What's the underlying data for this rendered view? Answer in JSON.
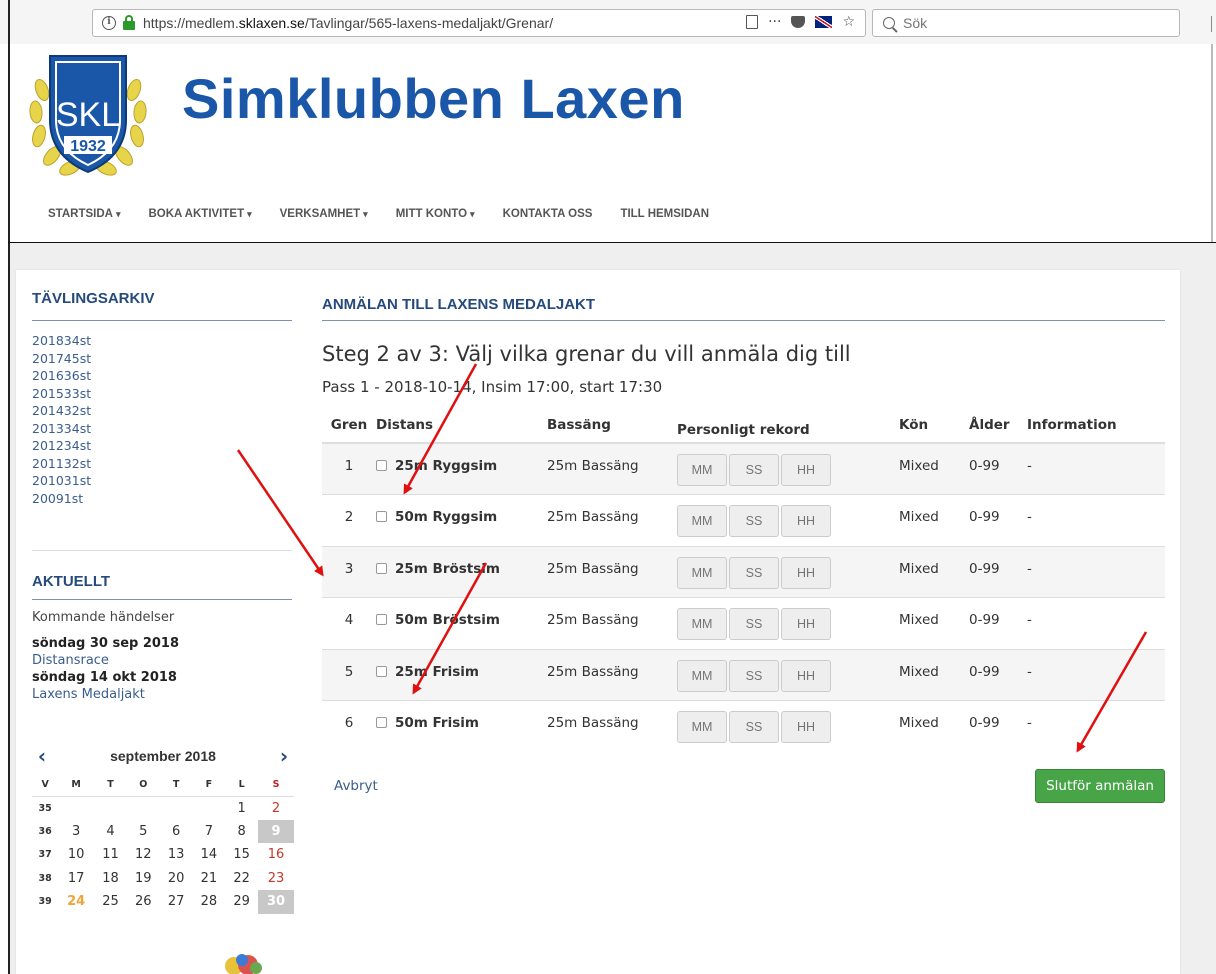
{
  "browser": {
    "url_prefix": "https://medlem.",
    "url_domain": "sklaxen.se",
    "url_path": "/Tavlingar/565-laxens-medaljakt/Grenar/",
    "search_placeholder": "Sök",
    "menu_dots": "···",
    "star": "☆"
  },
  "site": {
    "title": "Simklubben Laxen",
    "logo_text": "SKL",
    "logo_year": "1932"
  },
  "nav": [
    {
      "label": "STARTSIDA",
      "caret": "▾"
    },
    {
      "label": "BOKA AKTIVITET",
      "caret": "▾"
    },
    {
      "label": "VERKSAMHET",
      "caret": "▾"
    },
    {
      "label": "MITT KONTO",
      "caret": "▾"
    },
    {
      "label": "KONTAKTA OSS",
      "caret": ""
    },
    {
      "label": "TILL HEMSIDAN",
      "caret": ""
    }
  ],
  "sidebar": {
    "archive_heading": "TÄVLINGSARKIV",
    "archive": [
      "201834st",
      "201745st",
      "201636st",
      "201533st",
      "201432st",
      "201334st",
      "201234st",
      "201132st",
      "201031st",
      "20091st"
    ],
    "news_heading": "AKTUELLT",
    "upcoming_label": "Kommande händelser",
    "events": [
      {
        "date": "söndag 30 sep 2018",
        "name": "Distansrace"
      },
      {
        "date": "söndag 14 okt 2018",
        "name": "Laxens Medaljakt"
      }
    ]
  },
  "calendar": {
    "prev": "‹",
    "next": "›",
    "title": "september 2018",
    "headers": [
      "V",
      "M",
      "T",
      "O",
      "T",
      "F",
      "L",
      "S"
    ],
    "weeks": [
      [
        "35",
        "",
        "",
        "",
        "",
        "",
        "1",
        "2"
      ],
      [
        "36",
        "3",
        "4",
        "5",
        "6",
        "7",
        "8",
        "9"
      ],
      [
        "37",
        "10",
        "11",
        "12",
        "13",
        "14",
        "15",
        "16"
      ],
      [
        "38",
        "17",
        "18",
        "19",
        "20",
        "21",
        "22",
        "23"
      ],
      [
        "39",
        "24",
        "25",
        "26",
        "27",
        "28",
        "29",
        "30"
      ]
    ],
    "today": "24",
    "highlighted": [
      "9",
      "30"
    ]
  },
  "main": {
    "heading": "ANMÄLAN TILL LAXENS MEDALJAKT",
    "step": "Steg 2 av 3: Välj vilka grenar du vill anmäla dig till",
    "pass": "Pass 1 - 2018-10-14, Insim 17:00, start 17:30",
    "columns": [
      "Gren",
      "Distans",
      "Bassäng",
      "Personligt rekord",
      "Kön",
      "Ålder",
      "Information"
    ],
    "pr_placeholders": [
      "MM",
      "SS",
      "HH"
    ],
    "rows": [
      {
        "gren": "1",
        "distans": "25m Ryggsim",
        "bassang": "25m Bassäng",
        "kon": "Mixed",
        "alder": "0-99",
        "info": "-"
      },
      {
        "gren": "2",
        "distans": "50m Ryggsim",
        "bassang": "25m Bassäng",
        "kon": "Mixed",
        "alder": "0-99",
        "info": "-"
      },
      {
        "gren": "3",
        "distans": "25m Bröstsim",
        "bassang": "25m Bassäng",
        "kon": "Mixed",
        "alder": "0-99",
        "info": "-"
      },
      {
        "gren": "4",
        "distans": "50m Bröstsim",
        "bassang": "25m Bassäng",
        "kon": "Mixed",
        "alder": "0-99",
        "info": "-"
      },
      {
        "gren": "5",
        "distans": "25m Frisim",
        "bassang": "25m Bassäng",
        "kon": "Mixed",
        "alder": "0-99",
        "info": "-"
      },
      {
        "gren": "6",
        "distans": "50m Frisim",
        "bassang": "25m Bassäng",
        "kon": "Mixed",
        "alder": "0-99",
        "info": "-"
      }
    ],
    "cancel": "Avbryt",
    "submit": "Slutför anmälan"
  },
  "colors": {
    "brand_blue": "#1a57a8",
    "heading_blue": "#254a7c",
    "submit_green": "#47a447",
    "annotation_red": "#e01010"
  }
}
